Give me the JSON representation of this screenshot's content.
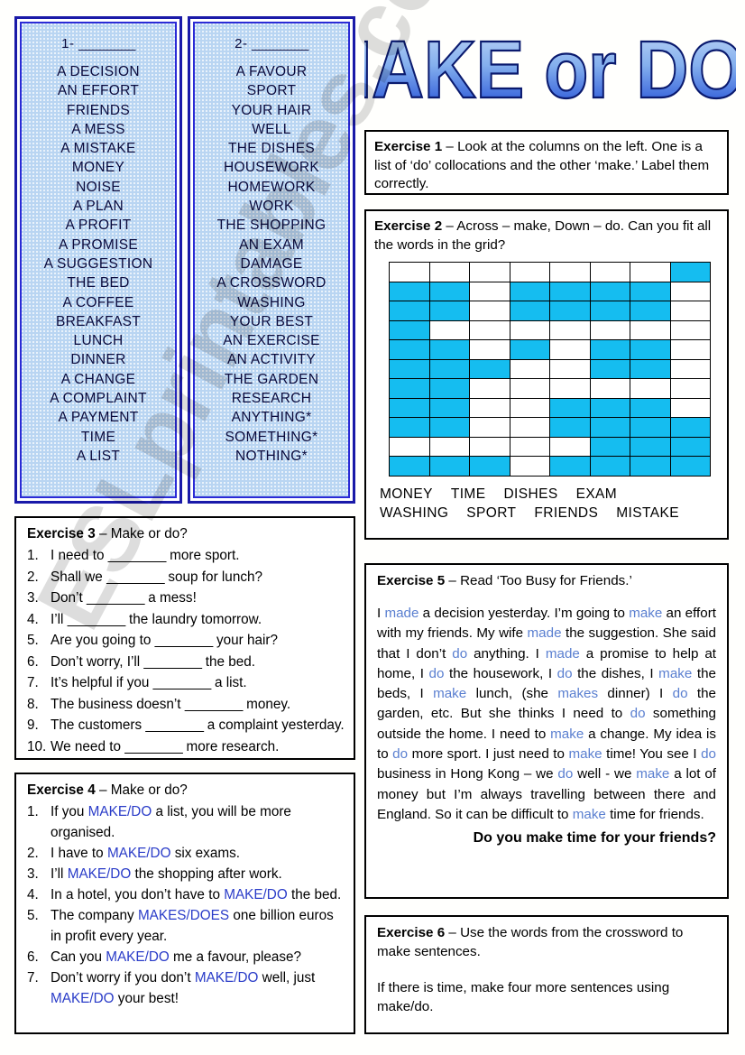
{
  "title": {
    "text": "MAKE or DO?",
    "color_light": "#a8c6f0",
    "color_dark": "#1a4fd6",
    "outline": "#0a1a6e"
  },
  "watermark": {
    "text": "ESLprintables.com"
  },
  "columns": [
    {
      "heading_number": "1-",
      "heading_blank": "________",
      "items": [
        "A DECISION",
        "AN EFFORT",
        "FRIENDS",
        "A MESS",
        "A MISTAKE",
        "MONEY",
        "NOISE",
        "A PLAN",
        "A PROFIT",
        "A PROMISE",
        "A SUGGESTION",
        "THE BED",
        "A COFFEE",
        "BREAKFAST",
        "LUNCH",
        "DINNER",
        "A CHANGE",
        "A COMPLAINT",
        "A PAYMENT",
        "TIME",
        "A LIST"
      ]
    },
    {
      "heading_number": "2-",
      "heading_blank": "________",
      "items": [
        "A FAVOUR",
        "SPORT",
        "YOUR HAIR",
        "WELL",
        "THE DISHES",
        "HOUSEWORK",
        "HOMEWORK",
        "WORK",
        "THE SHOPPING",
        "AN EXAM",
        "DAMAGE",
        "A CROSSWORD",
        "WASHING",
        "YOUR BEST",
        "AN EXERCISE",
        "AN ACTIVITY",
        "THE GARDEN",
        "RESEARCH",
        "ANYTHING*",
        "SOMETHING*",
        "NOTHING*"
      ]
    }
  ],
  "exercise1": {
    "label": "Exercise 1",
    "dash": " – ",
    "text": "Look at the columns on the left. One is a list of ‘do’ collocations and the other ‘make.’ Label them correctly."
  },
  "exercise2": {
    "label": "Exercise 2",
    "dash": " – ",
    "text": "Across – make, Down – do. Can you fit all the words in the grid?",
    "grid": {
      "cols": 8,
      "rows": 11,
      "filled_color": "#15bdf0",
      "empty_color": "#ffffff",
      "cells": [
        [
          0,
          0,
          0,
          0,
          0,
          0,
          0,
          1
        ],
        [
          1,
          1,
          0,
          1,
          1,
          1,
          1,
          0
        ],
        [
          1,
          1,
          0,
          1,
          1,
          1,
          1,
          0
        ],
        [
          1,
          0,
          0,
          0,
          0,
          0,
          0,
          0
        ],
        [
          1,
          1,
          0,
          1,
          0,
          1,
          1,
          0
        ],
        [
          1,
          1,
          1,
          0,
          0,
          1,
          1,
          0
        ],
        [
          1,
          1,
          0,
          0,
          0,
          0,
          0,
          0
        ],
        [
          1,
          1,
          0,
          0,
          1,
          1,
          1,
          0
        ],
        [
          1,
          1,
          0,
          0,
          1,
          1,
          1,
          1
        ],
        [
          0,
          0,
          0,
          0,
          0,
          1,
          1,
          1
        ],
        [
          1,
          1,
          1,
          0,
          1,
          1,
          1,
          1
        ]
      ]
    },
    "wordbank_row1": [
      "MONEY",
      "TIME",
      "DISHES",
      "EXAM"
    ],
    "wordbank_row2": [
      "WASHING",
      "SPORT",
      "FRIENDS",
      "MISTAKE"
    ]
  },
  "exercise3": {
    "label": "Exercise 3",
    "dash": " – ",
    "text": "Make or do?",
    "items": [
      {
        "num": "1.",
        "before": "I need to ",
        "blank": "________",
        "after": " more sport."
      },
      {
        "num": "2.",
        "before": "Shall we ",
        "blank": "________",
        "after": " soup for lunch?"
      },
      {
        "num": "3.",
        "before": "Don’t ",
        "blank": "________",
        "after": " a mess!"
      },
      {
        "num": "4.",
        "before": "I’ll ",
        "blank": "________",
        "after": " the laundry tomorrow."
      },
      {
        "num": "5.",
        "before": "Are you going to ",
        "blank": "________",
        "after": " your hair?"
      },
      {
        "num": "6.",
        "before": "Don’t worry, I’ll ",
        "blank": "________",
        "after": " the bed."
      },
      {
        "num": "7.",
        "before": "It’s helpful if you ",
        "blank": "________",
        "after": " a list."
      },
      {
        "num": "8.",
        "before": "The business doesn’t ",
        "blank": "________",
        "after": " money."
      },
      {
        "num": "9.",
        "before": "The customers ",
        "blank": "________",
        "after": " a complaint yesterday."
      },
      {
        "num": "10.",
        "before": "We need to ",
        "blank": "________",
        "after": " more research."
      }
    ]
  },
  "exercise4": {
    "label": "Exercise 4",
    "dash": " – ",
    "text": "Make or do?",
    "items": [
      {
        "num": "1.",
        "parts": [
          [
            "t",
            "If you "
          ],
          [
            "b",
            "MAKE/DO"
          ],
          [
            "t",
            " a list, you will be more organised."
          ]
        ]
      },
      {
        "num": "2.",
        "parts": [
          [
            "t",
            "I have to "
          ],
          [
            "b",
            "MAKE/DO"
          ],
          [
            "t",
            " six exams."
          ]
        ]
      },
      {
        "num": "3.",
        "parts": [
          [
            "t",
            "I’ll "
          ],
          [
            "b",
            "MAKE/DO"
          ],
          [
            "t",
            " the shopping after work."
          ]
        ]
      },
      {
        "num": "4.",
        "parts": [
          [
            "t",
            "In a hotel, you don’t have to "
          ],
          [
            "b",
            "MAKE/DO"
          ],
          [
            "t",
            " the bed."
          ]
        ]
      },
      {
        "num": "5.",
        "parts": [
          [
            "t",
            "The company "
          ],
          [
            "b",
            "MAKES/DOES"
          ],
          [
            "t",
            " one billion euros in profit every year."
          ]
        ]
      },
      {
        "num": "6.",
        "parts": [
          [
            "t",
            "Can you "
          ],
          [
            "b",
            "MAKE/DO"
          ],
          [
            "t",
            " me a favour, please?"
          ]
        ]
      },
      {
        "num": "7.",
        "parts": [
          [
            "t",
            "Don’t worry if you don’t "
          ],
          [
            "b",
            "MAKE/DO"
          ],
          [
            "t",
            " well, just "
          ],
          [
            "b",
            "MAKE/DO"
          ],
          [
            "t",
            " your best!"
          ]
        ]
      }
    ]
  },
  "exercise5": {
    "label": "Exercise 5",
    "dash": " – ",
    "text": "Read ‘Too Busy for Friends.’",
    "highlight_color": "#5a7fd0",
    "paragraph": [
      [
        "t",
        "I "
      ],
      [
        "h",
        "made"
      ],
      [
        "t",
        " a decision yesterday. I’m going to "
      ],
      [
        "h",
        "make"
      ],
      [
        "t",
        " an effort with my friends. My wife "
      ],
      [
        "h",
        "made"
      ],
      [
        "t",
        " the suggestion. She said that I don’t "
      ],
      [
        "h",
        "do"
      ],
      [
        "t",
        " anything. I "
      ],
      [
        "h",
        "made"
      ],
      [
        "t",
        " a promise to help at home, I "
      ],
      [
        "h",
        "do"
      ],
      [
        "t",
        " the housework, I "
      ],
      [
        "h",
        "do"
      ],
      [
        "t",
        " the dishes, I "
      ],
      [
        "h",
        "make"
      ],
      [
        "t",
        " the beds, I "
      ],
      [
        "h",
        "make"
      ],
      [
        "t",
        " lunch, (she "
      ],
      [
        "h",
        "makes"
      ],
      [
        "t",
        " dinner) I "
      ],
      [
        "h",
        "do"
      ],
      [
        "t",
        " the garden, etc. But she thinks I need to "
      ],
      [
        "h",
        "do"
      ],
      [
        "t",
        " something outside the home. I need to "
      ],
      [
        "h",
        "make"
      ],
      [
        "t",
        " a change. My idea is to "
      ],
      [
        "h",
        "do"
      ],
      [
        "t",
        " more sport. I just need to "
      ],
      [
        "h",
        "make"
      ],
      [
        "t",
        " time! You see I "
      ],
      [
        "h",
        "do"
      ],
      [
        "t",
        " business in Hong Kong – we "
      ],
      [
        "h",
        "do"
      ],
      [
        "t",
        " well - we "
      ],
      [
        "h",
        "make"
      ],
      [
        "t",
        " a lot of money but I’m always travelling between there and England. So it can be difficult to "
      ],
      [
        "h",
        "make"
      ],
      [
        "t",
        " time for friends."
      ]
    ],
    "closing": "Do you make time for your friends?"
  },
  "exercise6": {
    "label": "Exercise 6",
    "dash": " – ",
    "text": "Use the words from the crossword to make sentences.",
    "text2": "If there is time, make four more sentences using make/do."
  }
}
